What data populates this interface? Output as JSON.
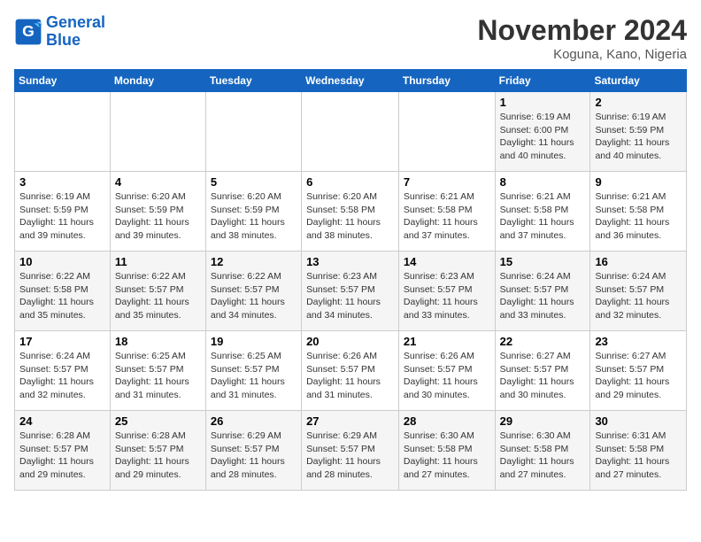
{
  "logo": {
    "line1": "General",
    "line2": "Blue"
  },
  "title": "November 2024",
  "location": "Koguna, Kano, Nigeria",
  "days_of_week": [
    "Sunday",
    "Monday",
    "Tuesday",
    "Wednesday",
    "Thursday",
    "Friday",
    "Saturday"
  ],
  "weeks": [
    [
      {
        "day": "",
        "info": ""
      },
      {
        "day": "",
        "info": ""
      },
      {
        "day": "",
        "info": ""
      },
      {
        "day": "",
        "info": ""
      },
      {
        "day": "",
        "info": ""
      },
      {
        "day": "1",
        "info": "Sunrise: 6:19 AM\nSunset: 6:00 PM\nDaylight: 11 hours\nand 40 minutes."
      },
      {
        "day": "2",
        "info": "Sunrise: 6:19 AM\nSunset: 5:59 PM\nDaylight: 11 hours\nand 40 minutes."
      }
    ],
    [
      {
        "day": "3",
        "info": "Sunrise: 6:19 AM\nSunset: 5:59 PM\nDaylight: 11 hours\nand 39 minutes."
      },
      {
        "day": "4",
        "info": "Sunrise: 6:20 AM\nSunset: 5:59 PM\nDaylight: 11 hours\nand 39 minutes."
      },
      {
        "day": "5",
        "info": "Sunrise: 6:20 AM\nSunset: 5:59 PM\nDaylight: 11 hours\nand 38 minutes."
      },
      {
        "day": "6",
        "info": "Sunrise: 6:20 AM\nSunset: 5:58 PM\nDaylight: 11 hours\nand 38 minutes."
      },
      {
        "day": "7",
        "info": "Sunrise: 6:21 AM\nSunset: 5:58 PM\nDaylight: 11 hours\nand 37 minutes."
      },
      {
        "day": "8",
        "info": "Sunrise: 6:21 AM\nSunset: 5:58 PM\nDaylight: 11 hours\nand 37 minutes."
      },
      {
        "day": "9",
        "info": "Sunrise: 6:21 AM\nSunset: 5:58 PM\nDaylight: 11 hours\nand 36 minutes."
      }
    ],
    [
      {
        "day": "10",
        "info": "Sunrise: 6:22 AM\nSunset: 5:58 PM\nDaylight: 11 hours\nand 35 minutes."
      },
      {
        "day": "11",
        "info": "Sunrise: 6:22 AM\nSunset: 5:57 PM\nDaylight: 11 hours\nand 35 minutes."
      },
      {
        "day": "12",
        "info": "Sunrise: 6:22 AM\nSunset: 5:57 PM\nDaylight: 11 hours\nand 34 minutes."
      },
      {
        "day": "13",
        "info": "Sunrise: 6:23 AM\nSunset: 5:57 PM\nDaylight: 11 hours\nand 34 minutes."
      },
      {
        "day": "14",
        "info": "Sunrise: 6:23 AM\nSunset: 5:57 PM\nDaylight: 11 hours\nand 33 minutes."
      },
      {
        "day": "15",
        "info": "Sunrise: 6:24 AM\nSunset: 5:57 PM\nDaylight: 11 hours\nand 33 minutes."
      },
      {
        "day": "16",
        "info": "Sunrise: 6:24 AM\nSunset: 5:57 PM\nDaylight: 11 hours\nand 32 minutes."
      }
    ],
    [
      {
        "day": "17",
        "info": "Sunrise: 6:24 AM\nSunset: 5:57 PM\nDaylight: 11 hours\nand 32 minutes."
      },
      {
        "day": "18",
        "info": "Sunrise: 6:25 AM\nSunset: 5:57 PM\nDaylight: 11 hours\nand 31 minutes."
      },
      {
        "day": "19",
        "info": "Sunrise: 6:25 AM\nSunset: 5:57 PM\nDaylight: 11 hours\nand 31 minutes."
      },
      {
        "day": "20",
        "info": "Sunrise: 6:26 AM\nSunset: 5:57 PM\nDaylight: 11 hours\nand 31 minutes."
      },
      {
        "day": "21",
        "info": "Sunrise: 6:26 AM\nSunset: 5:57 PM\nDaylight: 11 hours\nand 30 minutes."
      },
      {
        "day": "22",
        "info": "Sunrise: 6:27 AM\nSunset: 5:57 PM\nDaylight: 11 hours\nand 30 minutes."
      },
      {
        "day": "23",
        "info": "Sunrise: 6:27 AM\nSunset: 5:57 PM\nDaylight: 11 hours\nand 29 minutes."
      }
    ],
    [
      {
        "day": "24",
        "info": "Sunrise: 6:28 AM\nSunset: 5:57 PM\nDaylight: 11 hours\nand 29 minutes."
      },
      {
        "day": "25",
        "info": "Sunrise: 6:28 AM\nSunset: 5:57 PM\nDaylight: 11 hours\nand 29 minutes."
      },
      {
        "day": "26",
        "info": "Sunrise: 6:29 AM\nSunset: 5:57 PM\nDaylight: 11 hours\nand 28 minutes."
      },
      {
        "day": "27",
        "info": "Sunrise: 6:29 AM\nSunset: 5:57 PM\nDaylight: 11 hours\nand 28 minutes."
      },
      {
        "day": "28",
        "info": "Sunrise: 6:30 AM\nSunset: 5:58 PM\nDaylight: 11 hours\nand 27 minutes."
      },
      {
        "day": "29",
        "info": "Sunrise: 6:30 AM\nSunset: 5:58 PM\nDaylight: 11 hours\nand 27 minutes."
      },
      {
        "day": "30",
        "info": "Sunrise: 6:31 AM\nSunset: 5:58 PM\nDaylight: 11 hours\nand 27 minutes."
      }
    ]
  ]
}
